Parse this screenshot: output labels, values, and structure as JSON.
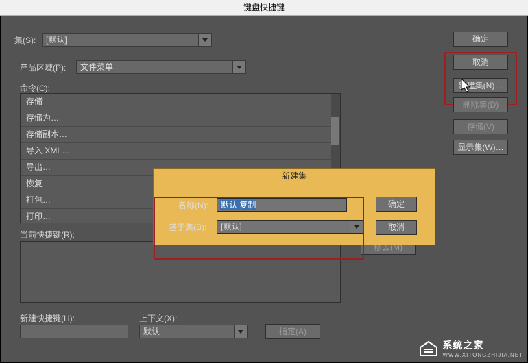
{
  "title": "键盘快捷键",
  "set": {
    "label": "集(S):",
    "value": "[默认]"
  },
  "product_area": {
    "label": "产品区域(P):",
    "value": "文件菜单"
  },
  "commands_label": "命令(C):",
  "commands": [
    "存储",
    "存储为…",
    "存储副本…",
    "导入 XML…",
    "导出…",
    "恢复",
    "打包…",
    "打印…"
  ],
  "current_shortcut": {
    "label": "当前快捷键(R):"
  },
  "new_shortcut": {
    "label": "新建快捷键(H):"
  },
  "context": {
    "label": "上下文(X):",
    "value": "默认"
  },
  "assign_btn": "指定(A)",
  "remove_btn": "移去(M)",
  "right_buttons": {
    "ok": "确定",
    "cancel": "取消",
    "new_set": "新建集(N)…",
    "delete_set": "删除集(D)",
    "save": "存储(V)",
    "show_set": "显示集(W)…"
  },
  "modal": {
    "title": "新建集",
    "name_label": "名称(N):",
    "name_value": "默认 复制",
    "based_on_label": "基于集(B):",
    "based_on_value": "[默认]",
    "ok": "确定",
    "cancel": "取消"
  },
  "watermark": {
    "brand": "系统之家",
    "url": "WWW.XITONGZHIJIA.NET"
  }
}
